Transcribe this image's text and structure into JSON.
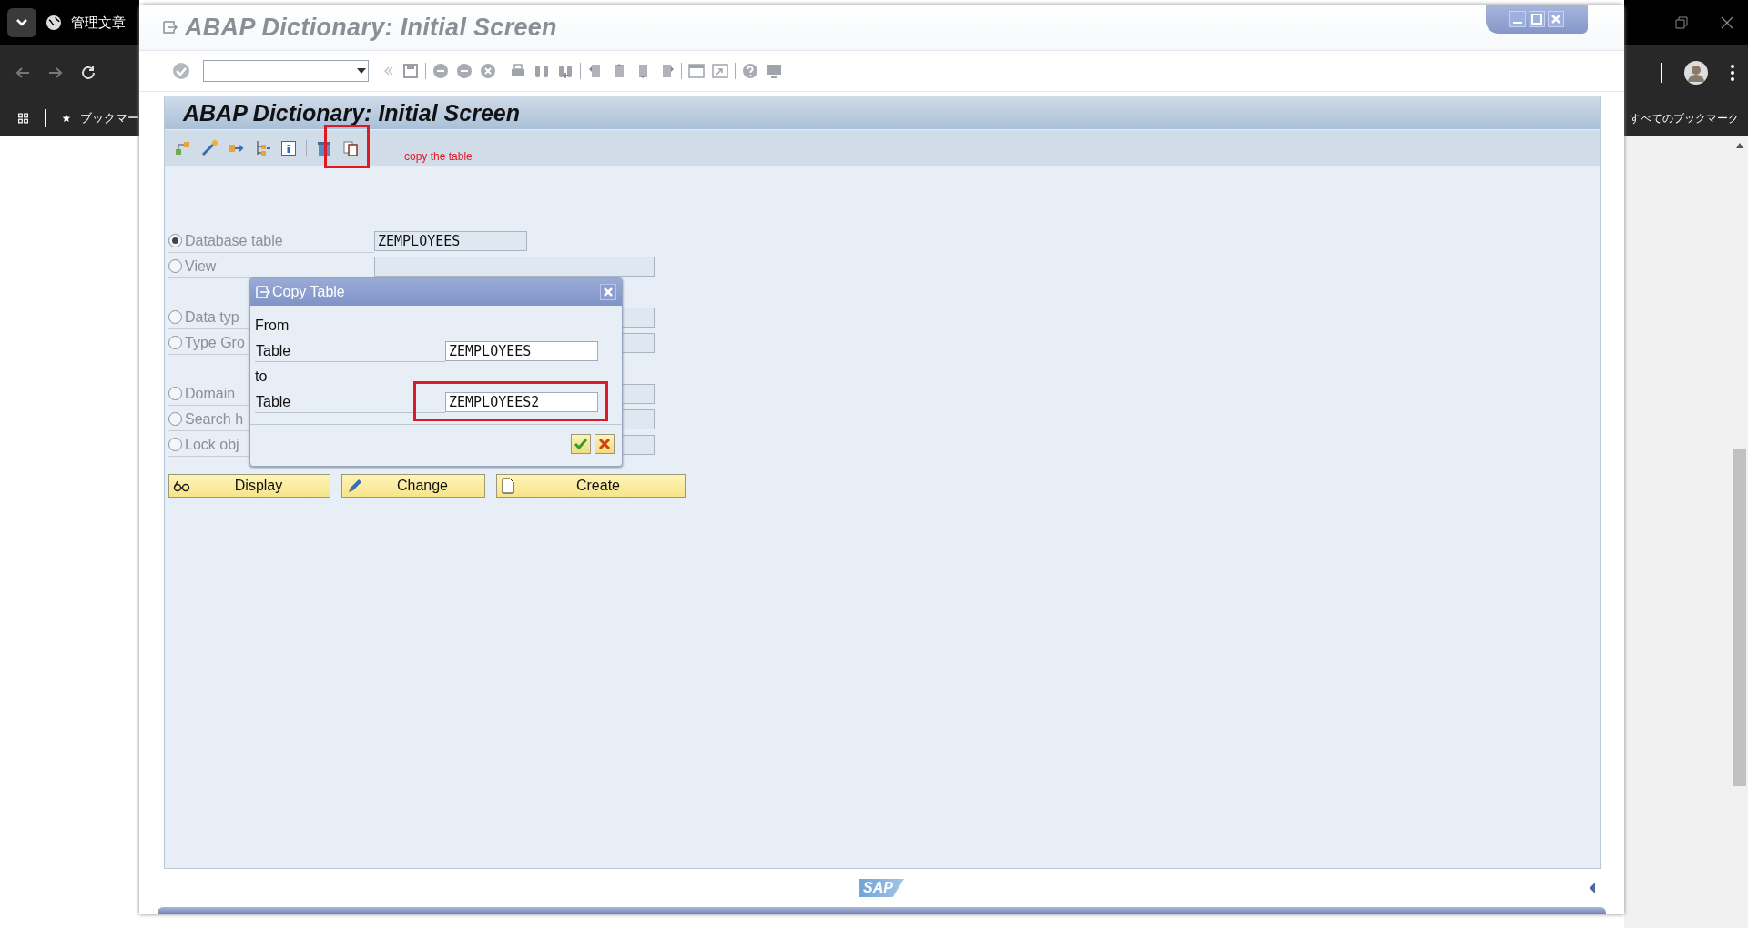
{
  "browser": {
    "tab_title": "管理文章",
    "bookmarks": "ブックマー",
    "all_bookmarks": "すべてのブックマーク"
  },
  "window": {
    "title": "ABAP Dictionary: Initial Screen"
  },
  "screen": {
    "title": "ABAP Dictionary: Initial Screen",
    "annotation": "copy the table"
  },
  "object_groups": [
    {
      "items": [
        {
          "label": "Database table",
          "selected": true,
          "value": "ZEMPLOYEES"
        },
        {
          "label": "View",
          "selected": false
        }
      ]
    },
    {
      "items": [
        {
          "label": "Data typ",
          "selected": false
        },
        {
          "label": "Type Gro",
          "selected": false
        }
      ]
    },
    {
      "items": [
        {
          "label": "Domain",
          "selected": false
        },
        {
          "label": "Search h",
          "selected": false
        },
        {
          "label": "Lock obj",
          "selected": false
        }
      ]
    }
  ],
  "dialog": {
    "title": "Copy Table",
    "from_label": "From",
    "from_table_label": "Table",
    "from_table": "ZEMPLOYEES",
    "to_label": "to",
    "to_table_label": "Table",
    "to_table": "ZEMPLOYEES2"
  },
  "buttons": [
    {
      "label": "Display",
      "kind": "display"
    },
    {
      "label": "Change",
      "kind": "change"
    },
    {
      "label": "Create",
      "kind": "create"
    }
  ],
  "footer": {
    "logo": "SAP"
  }
}
